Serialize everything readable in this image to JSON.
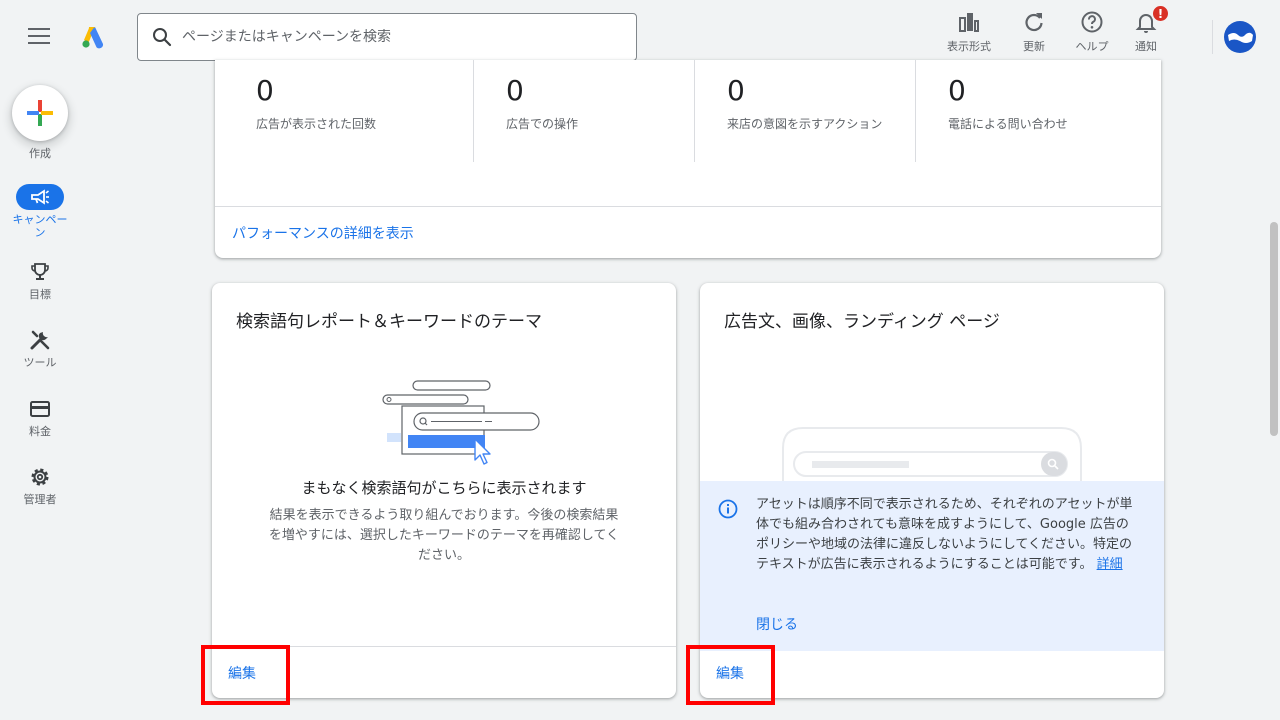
{
  "search": {
    "placeholder": "ページまたはキャンペーンを検索"
  },
  "header_actions": [
    {
      "label": "表示形式",
      "icon": "bar-chart-icon"
    },
    {
      "label": "更新",
      "icon": "refresh-icon"
    },
    {
      "label": "ヘルプ",
      "icon": "help-icon"
    },
    {
      "label": "通知",
      "icon": "bell-icon",
      "badge": "!"
    }
  ],
  "nav": {
    "create": "作成",
    "items": [
      {
        "label": "キャンペーン",
        "icon": "megaphone-icon",
        "active": true
      },
      {
        "label": "目標",
        "icon": "trophy-icon"
      },
      {
        "label": "ツール",
        "icon": "tools-icon"
      },
      {
        "label": "料金",
        "icon": "credit-card-icon"
      },
      {
        "label": "管理者",
        "icon": "gear-icon"
      }
    ]
  },
  "metrics": [
    {
      "value": "0",
      "label": "広告が表示された回数"
    },
    {
      "value": "0",
      "label": "広告での操作"
    },
    {
      "value": "0",
      "label": "来店の意図を示すアクション"
    },
    {
      "value": "0",
      "label": "電話による問い合わせ"
    }
  ],
  "metrics_link": "パフォーマンスの詳細を表示",
  "search_terms_card": {
    "title": "検索語句レポート＆キーワードのテーマ",
    "empty_title": "まもなく検索語句がこちらに表示されます",
    "empty_body": "結果を表示できるよう取り組んでおります。今後の検索結果を増やすには、選択したキーワードのテーマを再確認してください。",
    "edit": "編集"
  },
  "ads_card": {
    "title": "広告文、画像、ランディング ページ",
    "info_text": "アセットは順序不同で表示されるため、それぞれのアセットが単体でも組み合わされても意味を成すようにして、Google 広告のポリシーや地域の法律に違反しないようにしてください。特定のテキストが広告に表示されるようにすることは可能です。",
    "info_link": "詳細",
    "close": "閉じる",
    "edit": "編集"
  }
}
